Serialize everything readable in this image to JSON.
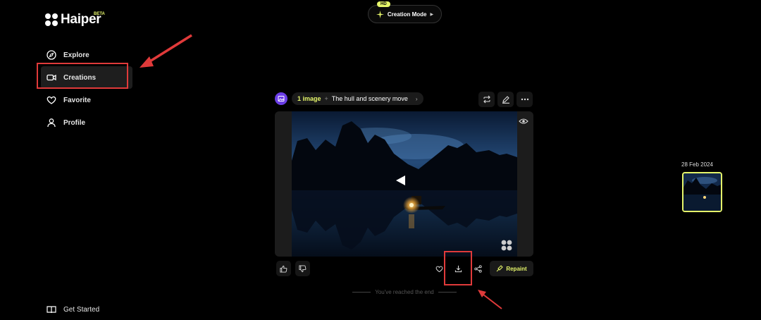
{
  "brand": {
    "name": "Haiper",
    "badge": "BETA"
  },
  "mode": {
    "badge": "HD",
    "label": "Creation Mode"
  },
  "sidebar": {
    "items": [
      {
        "label": "Explore",
        "icon": "compass-icon"
      },
      {
        "label": "Creations",
        "icon": "video-camera-icon",
        "active": true
      },
      {
        "label": "Favorite",
        "icon": "heart-icon"
      },
      {
        "label": "Profile",
        "icon": "user-icon"
      }
    ],
    "footer": {
      "label": "Get Started",
      "icon": "book-icon"
    }
  },
  "creation": {
    "image_count": "1 image",
    "plus": "+",
    "prompt": "The hull and scenery move",
    "repaint_label": "Repaint"
  },
  "end_message": "You've reached the end",
  "timeline": {
    "date": "28 Feb 2024"
  },
  "colors": {
    "accent": "#e5f56a",
    "annotation": "#e03a3a",
    "image_badge": "#6b3ee6"
  }
}
